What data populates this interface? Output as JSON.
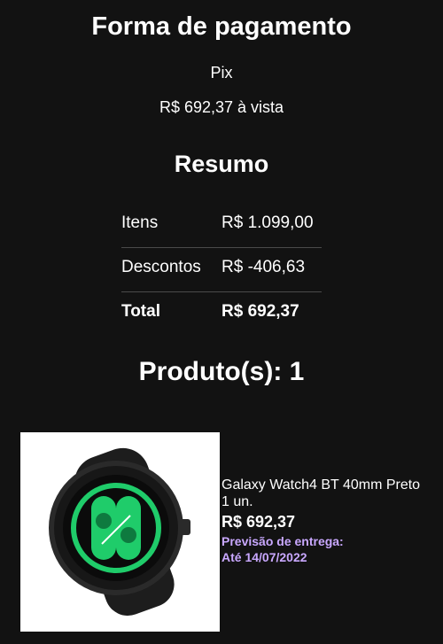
{
  "payment": {
    "title": "Forma de pagamento",
    "method": "Pix",
    "amount": "R$ 692,37 à vista"
  },
  "summary": {
    "title": "Resumo",
    "rows": [
      {
        "label": "Itens",
        "value": "R$ 1.099,00"
      },
      {
        "label": "Descontos",
        "value": "R$ -406,63"
      },
      {
        "label": "Total",
        "value": "R$ 692,37"
      }
    ]
  },
  "products": {
    "title": "Produto(s): 1",
    "items": [
      {
        "name": "Galaxy Watch4 BT 40mm Preto",
        "quantity": "1 un.",
        "price": "R$ 692,37",
        "delivery_label": "Previsão de entrega:",
        "delivery_date": "Até 14/07/2022"
      }
    ]
  },
  "colors": {
    "background": "#121212",
    "delivery_accent": "#c9a8ff",
    "watch_face": "#1fcc6a"
  }
}
